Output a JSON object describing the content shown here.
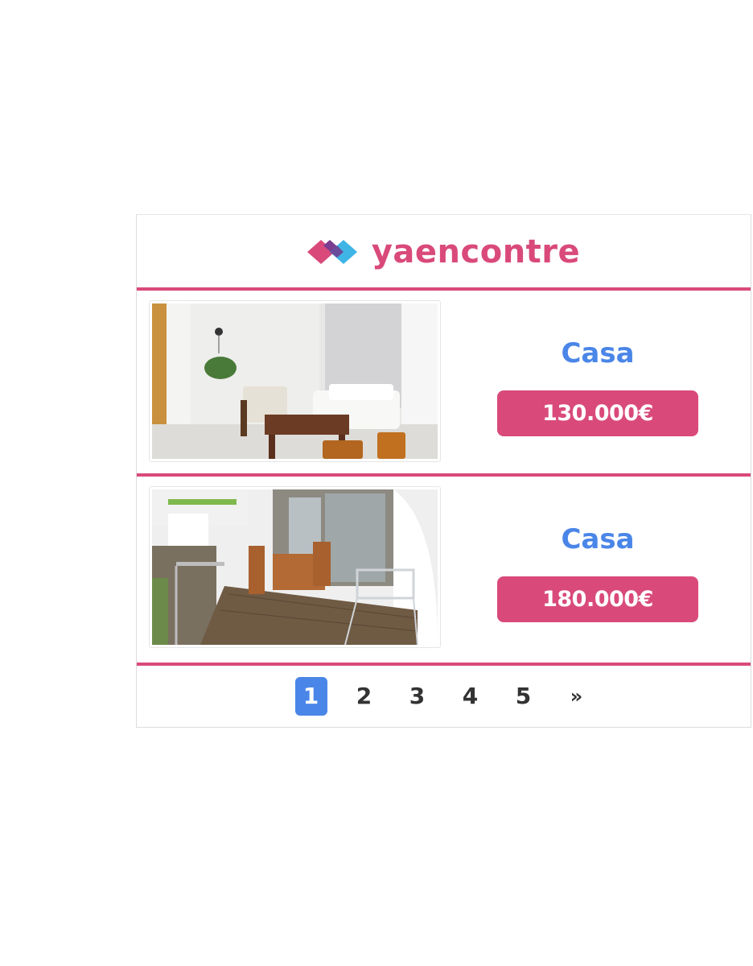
{
  "brand": {
    "name": "yaencontre",
    "colors": {
      "pink": "#d94a7b",
      "purple": "#7a3d8f",
      "blue": "#3fb5e6"
    }
  },
  "listings": [
    {
      "type": "Casa",
      "price": "130.000€",
      "photo": "living-room-photo"
    },
    {
      "type": "Casa",
      "price": "180.000€",
      "photo": "terrace-photo"
    }
  ],
  "pagination": {
    "pages": [
      "1",
      "2",
      "3",
      "4",
      "5"
    ],
    "next": "»",
    "current": "1"
  },
  "colors": {
    "accent": "#d94a7b",
    "link": "#4a86e8"
  }
}
